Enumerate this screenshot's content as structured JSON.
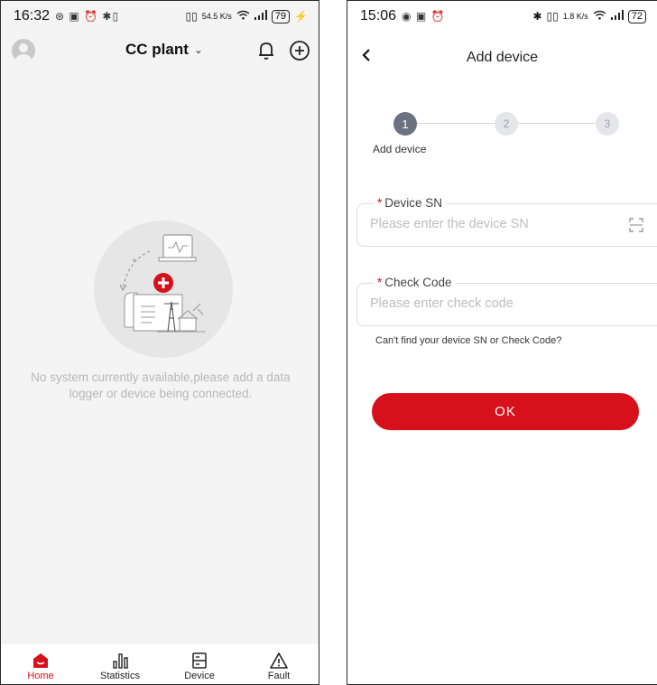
{
  "left_screen": {
    "status_bar": {
      "time": "16:32",
      "icons": "⊛ ▣ ⏰ ✱▯",
      "net_speed": "54.5 K/s",
      "battery": "79"
    },
    "header": {
      "plant_name": "CC plant",
      "dropdown_icon": "chevron-down-icon",
      "notification_icon": "bell-icon",
      "add_icon": "plus-circle-icon"
    },
    "empty_state": {
      "message": "No system currently available,please add a data logger or device being connected."
    },
    "tabbar": {
      "items": [
        {
          "label": "Home",
          "icon": "home-icon",
          "active": true
        },
        {
          "label": "Statistics",
          "icon": "bar-chart-icon",
          "active": false
        },
        {
          "label": "Device",
          "icon": "device-icon",
          "active": false
        },
        {
          "label": "Fault",
          "icon": "warning-icon",
          "active": false
        }
      ]
    }
  },
  "right_screen": {
    "status_bar": {
      "time": "15:06",
      "icons": "◉ ▣ ⏰",
      "net_speed": "1.8 K/s",
      "battery": "72"
    },
    "header": {
      "back_icon": "back-arrow-icon",
      "title": "Add device"
    },
    "stepper": {
      "steps": [
        "1",
        "2",
        "3"
      ],
      "active_step": 1,
      "active_label": "Add device"
    },
    "device_sn": {
      "label": "Device SN",
      "placeholder": "Please enter the device SN",
      "value": ""
    },
    "check_code": {
      "label": "Check Code",
      "placeholder": "Please enter check code",
      "value": ""
    },
    "help_link": "Can't find your device SN or Check Code?",
    "ok_label": "OK"
  },
  "colors": {
    "accent": "#d6111b",
    "step_active": "#6b7380",
    "left_background": "#f4f4f4"
  }
}
